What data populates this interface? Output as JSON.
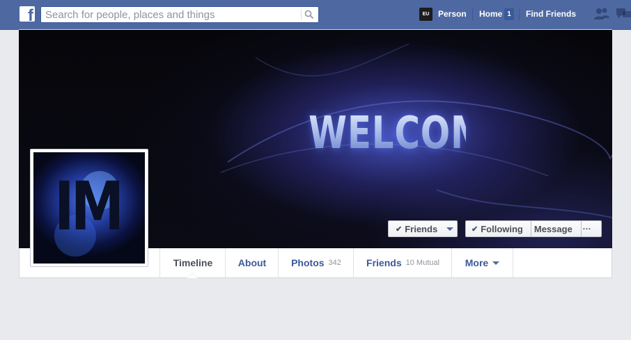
{
  "topbar": {
    "logo_letter": "f",
    "search": {
      "placeholder": "Search for people, places and things",
      "value": ""
    },
    "user_avatar_text": "EU",
    "user_name": "Person",
    "home_label": "Home",
    "home_badge": "1",
    "find_friends_label": "Find Friends",
    "icons": [
      "facebook-logo",
      "search-icon",
      "friend-requests-icon",
      "messages-icon"
    ]
  },
  "cover": {
    "text": "WELCOME",
    "buttons": {
      "friends_label": "Friends",
      "following_label": "Following",
      "message_label": "Message",
      "more_label": "···",
      "check_glyph": "✔"
    }
  },
  "profile_picture": {
    "text": "IM"
  },
  "tabs": [
    {
      "label": "Timeline",
      "count": "",
      "active": true
    },
    {
      "label": "About",
      "count": ""
    },
    {
      "label": "Photos",
      "count": "342"
    },
    {
      "label": "Friends",
      "count": "10 Mutual"
    },
    {
      "label": "More",
      "count": ""
    }
  ],
  "colors": {
    "brand_blue": "#4e69a2",
    "link_blue": "#3b5998",
    "page_bg": "#e9eaed"
  }
}
